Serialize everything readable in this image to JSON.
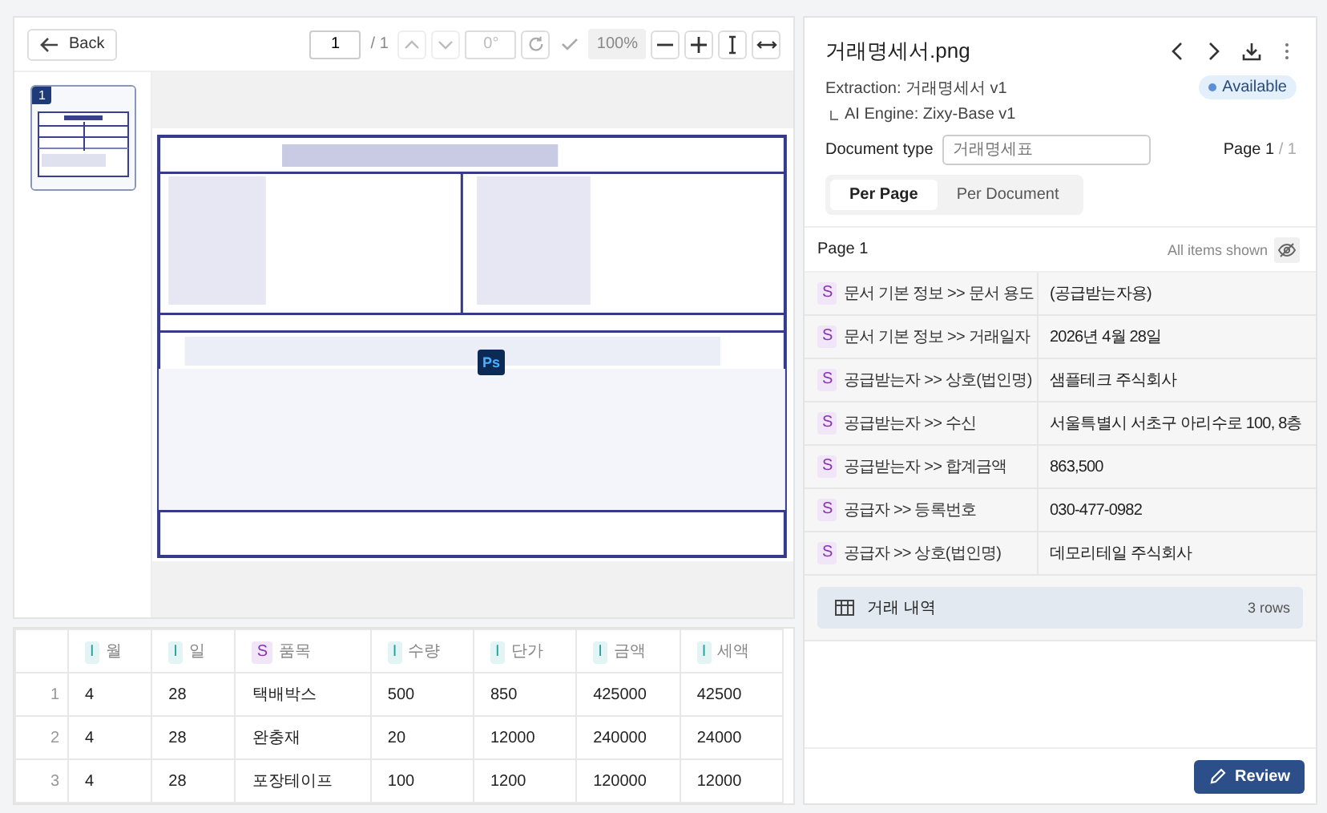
{
  "toolbar": {
    "back": "Back",
    "page_input": "1",
    "page_total": "/ 1",
    "rotation": "0°",
    "zoom": "100%"
  },
  "thumbnails": [
    {
      "page": "1",
      "selected": true
    }
  ],
  "overlay_badge": "Ps",
  "data_table": {
    "columns": [
      {
        "type": "I",
        "label": "월"
      },
      {
        "type": "I",
        "label": "일"
      },
      {
        "type": "S",
        "label": "품목"
      },
      {
        "type": "I",
        "label": "수량"
      },
      {
        "type": "I",
        "label": "단가"
      },
      {
        "type": "I",
        "label": "금액"
      },
      {
        "type": "I",
        "label": "세액"
      }
    ],
    "rows": [
      {
        "index": "1",
        "cells": [
          "4",
          "28",
          "택배박스",
          "500",
          "850",
          "425000",
          "42500"
        ]
      },
      {
        "index": "2",
        "cells": [
          "4",
          "28",
          "완충재",
          "20",
          "12000",
          "240000",
          "24000"
        ]
      },
      {
        "index": "3",
        "cells": [
          "4",
          "28",
          "포장테이프",
          "100",
          "1200",
          "120000",
          "12000"
        ]
      }
    ]
  },
  "panel": {
    "file_name": "거래명세서.png",
    "extraction": "Extraction: 거래명세서 v1",
    "status": "Available",
    "engine": "AI Engine: Zixy-Base v1",
    "doc_type_label": "Document type",
    "doc_type_placeholder": "거래명세표",
    "page_label": "Page 1",
    "page_total": "/ 1",
    "view_tabs": [
      {
        "label": "Per Page",
        "selected": true
      },
      {
        "label": "Per Document",
        "selected": false
      }
    ],
    "section_title": "Page 1",
    "visibility": "All items shown",
    "fields": [
      {
        "type": "S",
        "label": "문서 기본 정보 >> 문서 용도",
        "value": "(공급받는자용)"
      },
      {
        "type": "S",
        "label": "문서 기본 정보 >> 거래일자",
        "value": "2026년 4월 28일"
      },
      {
        "type": "S",
        "label": "공급받는자 >> 상호(법인명)",
        "value": "샘플테크 주식회사"
      },
      {
        "type": "S",
        "label": "공급받는자 >> 수신",
        "value": "서울특별시 서초구 아리수로 100, 8층"
      },
      {
        "type": "S",
        "label": "공급받는자 >> 합계금액",
        "value": "863,500"
      },
      {
        "type": "S",
        "label": "공급자 >> 등록번호",
        "value": "030-477-0982"
      },
      {
        "type": "S",
        "label": "공급자 >> 상호(법인명)",
        "value": "데모리테일 주식회사"
      }
    ],
    "tables": [
      {
        "label": "거래 내역",
        "count": "3 rows"
      }
    ],
    "review": "Review"
  }
}
